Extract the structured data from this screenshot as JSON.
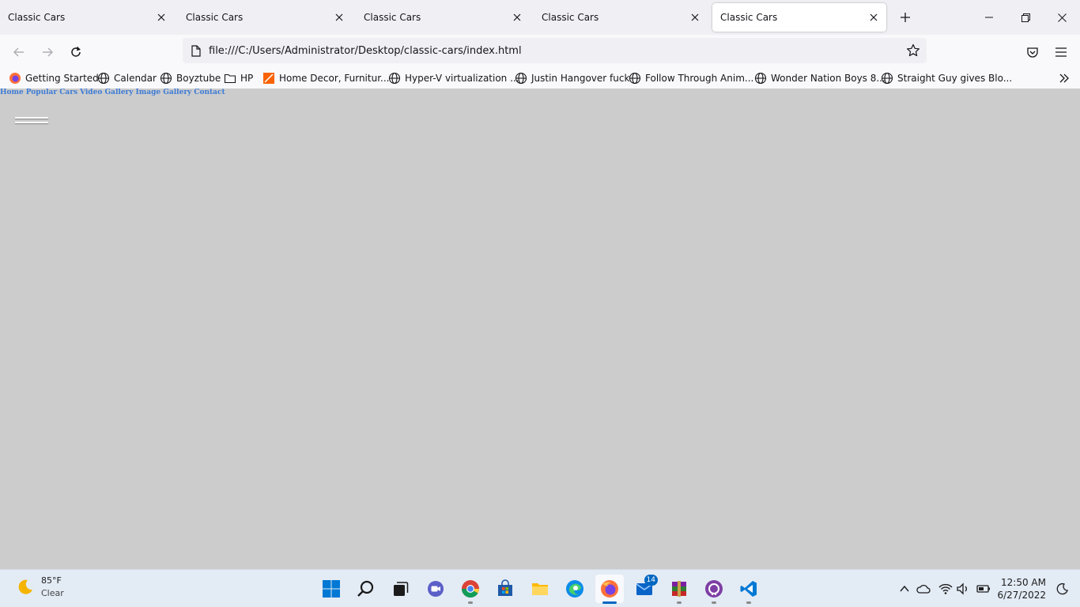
{
  "tabs": [
    {
      "title": "Classic Cars"
    },
    {
      "title": "Classic Cars"
    },
    {
      "title": "Classic Cars"
    },
    {
      "title": "Classic Cars"
    },
    {
      "title": "Classic Cars",
      "active": true
    }
  ],
  "toolbar": {
    "url": "file:///C:/Users/Administrator/Desktop/classic-cars/index.html"
  },
  "bookmarks": [
    {
      "label": "Getting Started",
      "icon": "firefox-icon"
    },
    {
      "label": "Calendar",
      "icon": "globe-icon"
    },
    {
      "label": "Boyztube",
      "icon": "globe-icon"
    },
    {
      "label": "HP",
      "icon": "folder-icon"
    },
    {
      "label": "Home Decor, Furnitur...",
      "icon": "home-depot-icon"
    },
    {
      "label": "Hyper-V virtualization ...",
      "icon": "globe-icon"
    },
    {
      "label": "Justin Hangover fuck",
      "icon": "globe-icon"
    },
    {
      "label": "Follow Through Anim...",
      "icon": "globe-icon"
    },
    {
      "label": "Wonder Nation Boys 8...",
      "icon": "globe-icon"
    },
    {
      "label": "Straight Guy gives Blo...",
      "icon": "globe-icon"
    }
  ],
  "site": {
    "nav": [
      "Home",
      "Popular Cars",
      "Video Gallery",
      "Image Gallery",
      "Contact"
    ],
    "link_color": "#3d7bd6",
    "background": "#cccccc"
  },
  "taskbar": {
    "weather": {
      "temp": "85°F",
      "condition": "Clear"
    },
    "apps": [
      {
        "name": "start"
      },
      {
        "name": "search"
      },
      {
        "name": "task-view"
      },
      {
        "name": "chat"
      },
      {
        "name": "chrome"
      },
      {
        "name": "store"
      },
      {
        "name": "file-explorer"
      },
      {
        "name": "edge"
      },
      {
        "name": "firefox",
        "active": true
      },
      {
        "name": "mail",
        "badge": "14"
      },
      {
        "name": "winrar"
      },
      {
        "name": "github-desktop"
      },
      {
        "name": "vscode"
      }
    ],
    "clock": {
      "time": "12:50 AM",
      "date": "6/27/2022"
    }
  }
}
